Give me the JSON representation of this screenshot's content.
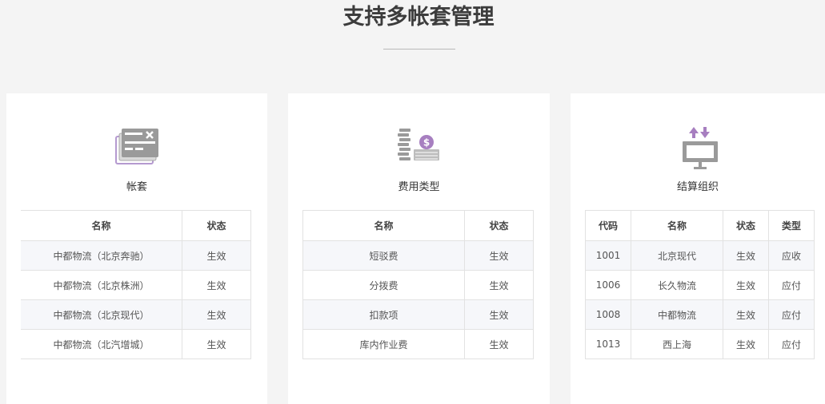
{
  "page": {
    "title": "支持多帐套管理"
  },
  "cards": [
    {
      "label": "帐套",
      "icon": "ledger-icon",
      "headers": [
        "名称",
        "状态"
      ],
      "rows": [
        [
          "中都物流（北京奔驰）",
          "生效"
        ],
        [
          "中都物流（北京株洲）",
          "生效"
        ],
        [
          "中都物流（北京现代）",
          "生效"
        ],
        [
          "中都物流（北汽增城）",
          "生效"
        ]
      ]
    },
    {
      "label": "费用类型",
      "icon": "coins-money-icon",
      "headers": [
        "名称",
        "状态"
      ],
      "rows": [
        [
          "短驳费",
          "生效"
        ],
        [
          "分拨费",
          "生效"
        ],
        [
          "扣款项",
          "生效"
        ],
        [
          "库内作业费",
          "生效"
        ]
      ]
    },
    {
      "label": "结算组织",
      "icon": "transfer-monitor-icon",
      "headers": [
        "代码",
        "名称",
        "状态",
        "类型"
      ],
      "rows": [
        [
          "1001",
          "北京现代",
          "生效",
          "应收"
        ],
        [
          "1006",
          "长久物流",
          "生效",
          "应付"
        ],
        [
          "1008",
          "中都物流",
          "生效",
          "应付"
        ],
        [
          "1013",
          "西上海",
          "生效",
          "应付"
        ]
      ]
    }
  ],
  "colors": {
    "icon_gray": "#9a9a9a",
    "icon_purple": "#a77fc0"
  }
}
